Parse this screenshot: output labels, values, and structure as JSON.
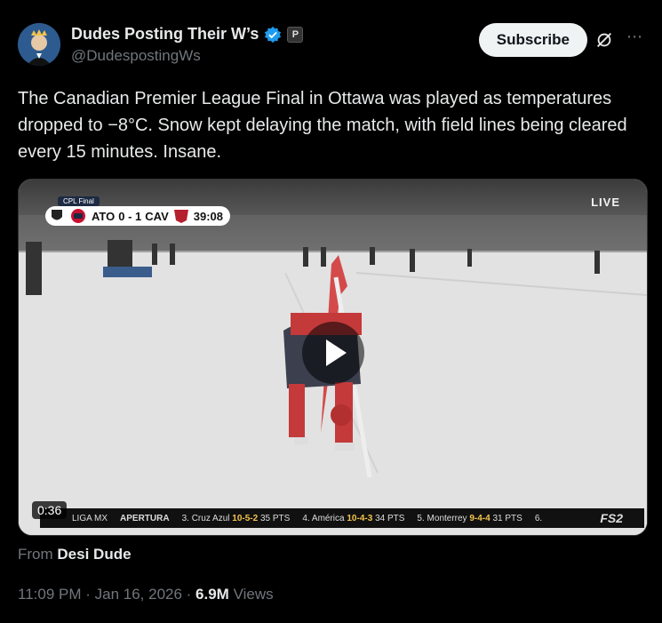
{
  "author": {
    "name": "Dudes Posting Their W’s",
    "handle": "@DudespostingWs",
    "affiliate_badge": "P"
  },
  "actions": {
    "subscribe_label": "Subscribe"
  },
  "post": {
    "text": "The Canadian Premier League Final in Ottawa was played as temperatures dropped to −8°C. Snow kept delaying the match, with field lines being cleared every 15 minutes. Insane."
  },
  "video": {
    "competition_tag": "CPL Final",
    "home_team": "ATO",
    "score": "0 - 1",
    "away_team": "CAV",
    "clock": "39:08",
    "live_label": "LIVE",
    "duration": "0:36",
    "ticker_league": "LIGA MX",
    "ticker_label": "APERTURA",
    "ticker_items": [
      {
        "rank": "3.",
        "team": "Cruz Azul",
        "record": "10-5-2",
        "pts": "35 PTS"
      },
      {
        "rank": "4.",
        "team": "América",
        "record": "10-4-3",
        "pts": "34 PTS"
      },
      {
        "rank": "5.",
        "team": "Monterrey",
        "record": "9-4-4",
        "pts": "31 PTS"
      },
      {
        "rank": "6.",
        "team": "",
        "record": "",
        "pts": ""
      }
    ],
    "network": "FS2"
  },
  "source": {
    "prefix": "From",
    "name": "Desi Dude"
  },
  "meta": {
    "time": "11:09 PM",
    "date": "Jan 16, 2026",
    "views_count": "6.9M",
    "views_label": "Views"
  },
  "colors": {
    "verified": "#1d9bf0",
    "background": "#000000",
    "muted": "#71767b"
  }
}
